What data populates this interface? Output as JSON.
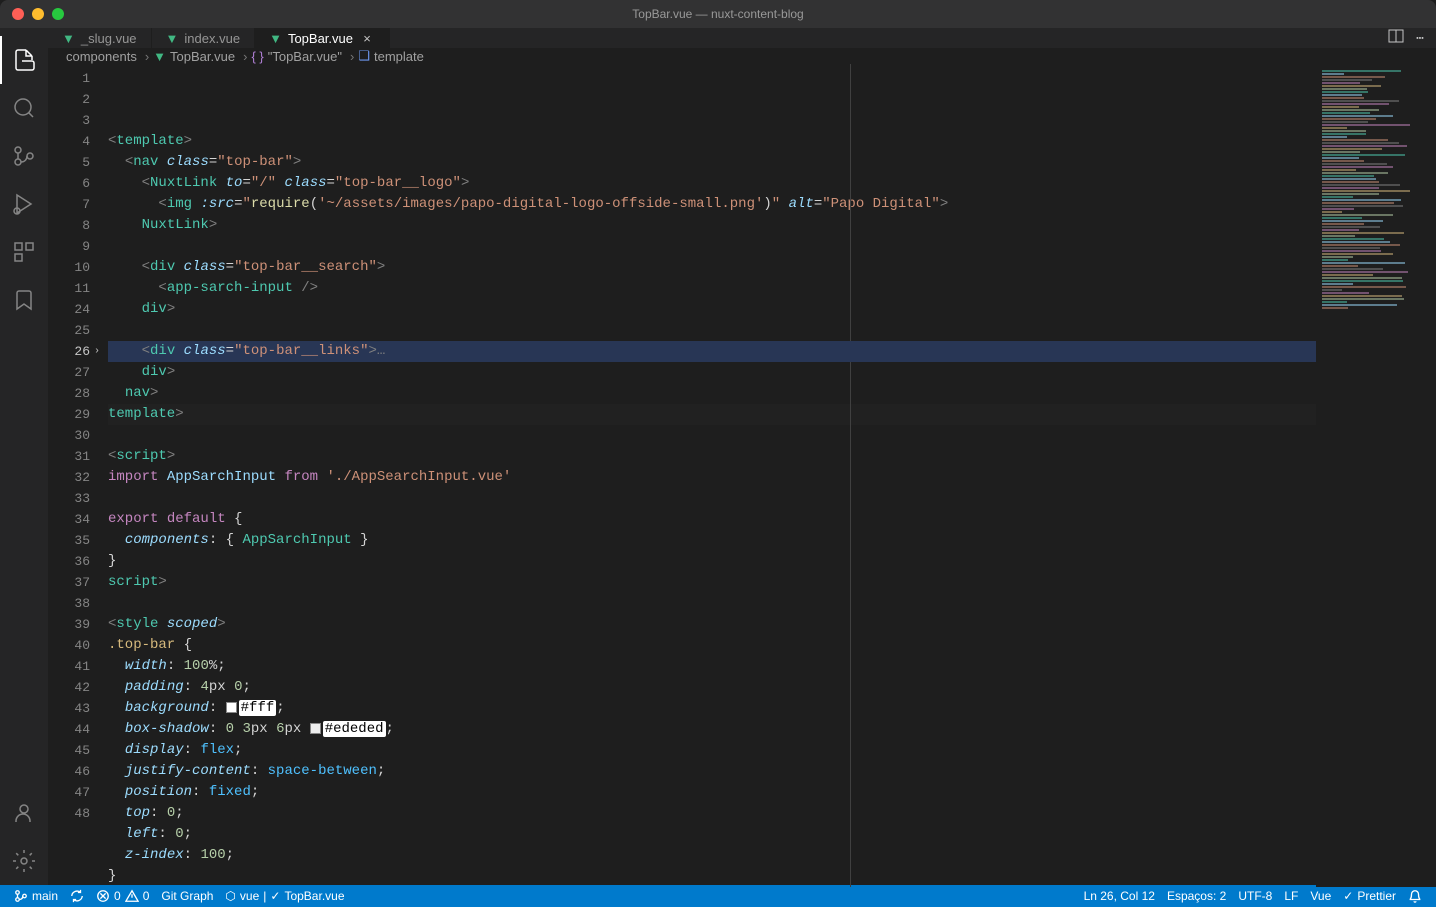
{
  "window": {
    "title": "TopBar.vue — nuxt-content-blog"
  },
  "tabs": [
    {
      "label": "_slug.vue",
      "active": false
    },
    {
      "label": "index.vue",
      "active": false
    },
    {
      "label": "TopBar.vue",
      "active": true
    }
  ],
  "breadcrumbs": {
    "folder": "components",
    "file": "TopBar.vue",
    "symbol_quoted": "\"TopBar.vue\"",
    "symbol": "template"
  },
  "editor": {
    "line_numbers": [
      "1",
      "2",
      "3",
      "4",
      "5",
      "6",
      "7",
      "8",
      "9",
      "10",
      "11",
      "24",
      "25",
      "26",
      "27",
      "28",
      "29",
      "30",
      "31",
      "32",
      "33",
      "34",
      "35",
      "36",
      "37",
      "38",
      "39",
      "40",
      "41",
      "42",
      "43",
      "44",
      "45",
      "46",
      "47",
      "48"
    ],
    "current_line_index": 13,
    "highlighted_line_index": 10,
    "code": {
      "l1": {
        "open": "<",
        "tag": "template",
        "close": ">"
      },
      "l2": {
        "open": "<",
        "tag": "nav",
        "attr": "class",
        "eq": "=",
        "str": "\"top-bar\"",
        "close": ">"
      },
      "l3": {
        "open": "<",
        "tag": "NuxtLink",
        "attr1": "to",
        "str1": "\"/\"",
        "attr2": "class",
        "str2": "\"top-bar__logo\"",
        "close": ">"
      },
      "l4": {
        "open": "<",
        "tag": "img",
        "attr1": ":src",
        "fn": "require",
        "str1": "'~/assets/images/papo-digital-logo-offside-small.png'",
        "attr2": "alt",
        "str2": "\"Papo Digital\"",
        "close": ">"
      },
      "l5": {
        "open": "</",
        "tag": "NuxtLink",
        "close": ">"
      },
      "l7": {
        "open": "<",
        "tag": "div",
        "attr": "class",
        "str": "\"top-bar__search\"",
        "close": ">"
      },
      "l8": {
        "open": "<",
        "tag": "app-sarch-input",
        "close": "/>"
      },
      "l9": {
        "open": "</",
        "tag": "div",
        "close": ">"
      },
      "l11": {
        "open": "<",
        "tag": "div",
        "attr": "class",
        "str": "\"top-bar__links\"",
        "close": ">",
        "fold": "…"
      },
      "l24": {
        "open": "</",
        "tag": "div",
        "close": ">"
      },
      "l25": {
        "open": "</",
        "tag": "nav",
        "close": ">"
      },
      "l26": {
        "open": "</",
        "tag": "template",
        "close": ">"
      },
      "l28": {
        "open": "<",
        "tag": "script",
        "close": ">"
      },
      "l29": {
        "kw": "import",
        "name": "AppSarchInput",
        "from": "from",
        "str": "'./AppSearchInput.vue'"
      },
      "l31": {
        "kw1": "export",
        "kw2": "default",
        "brace": "{"
      },
      "l32": {
        "prop": "components",
        "colon": ":",
        "open": "{ ",
        "name": "AppSarchInput",
        "close": " }"
      },
      "l33": {
        "brace": "}"
      },
      "l34": {
        "open": "</",
        "tag": "script",
        "close": ">"
      },
      "l36": {
        "open": "<",
        "tag": "style",
        "attr": "scoped",
        "close": ">"
      },
      "l37": {
        "sel": ".top-bar",
        "brace": " {"
      },
      "l38": {
        "prop": "width",
        "val": "100",
        "unit": "%",
        "semi": ";"
      },
      "l39": {
        "prop": "padding",
        "val1": "4",
        "u1": "px",
        "val2": "0",
        "semi": ";"
      },
      "l40": {
        "prop": "background",
        "swatch": "#ffffff",
        "hex": "#fff",
        "semi": ";"
      },
      "l41": {
        "prop": "box-shadow",
        "v0": "0",
        "v1": "3",
        "u1": "px",
        "v2": "6",
        "u2": "px",
        "swatch": "#ededed",
        "hex": "#ededed",
        "semi": ";"
      },
      "l42": {
        "prop": "display",
        "val": "flex",
        "semi": ";"
      },
      "l43": {
        "prop": "justify-content",
        "val": "space-between",
        "semi": ";"
      },
      "l44": {
        "prop": "position",
        "val": "fixed",
        "semi": ";"
      },
      "l45": {
        "prop": "top",
        "val": "0",
        "semi": ";"
      },
      "l46": {
        "prop": "left",
        "val": "0",
        "semi": ";"
      },
      "l47": {
        "prop": "z-index",
        "val": "100",
        "semi": ";"
      },
      "l48": {
        "brace": "}"
      }
    }
  },
  "statusbar": {
    "branch": "main",
    "errors": "0",
    "warnings": "0",
    "gitgraph": "Git Graph",
    "eslint_logo": "vue",
    "eslint_file": "TopBar.vue",
    "cursor": "Ln 26, Col 12",
    "spaces": "Espaços: 2",
    "encoding": "UTF-8",
    "eol": "LF",
    "lang": "Vue",
    "prettier": "Prettier"
  }
}
